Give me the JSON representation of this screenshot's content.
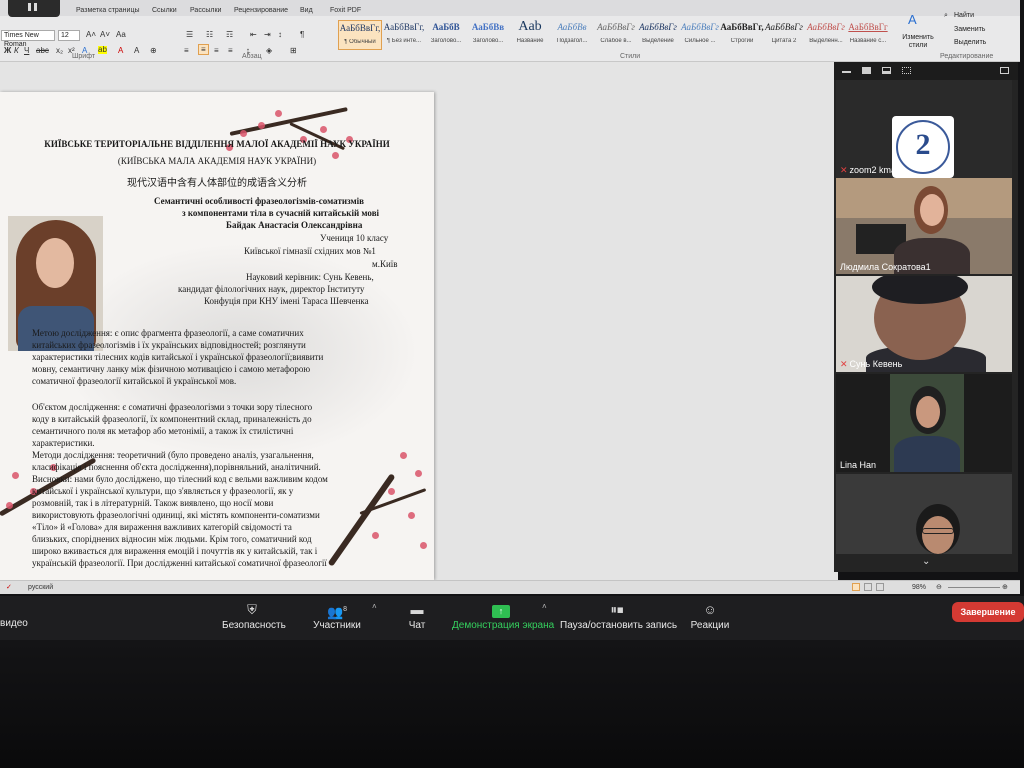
{
  "word": {
    "tabs": [
      "Разметка страницы",
      "Ссылки",
      "Рассылки",
      "Рецензирование",
      "Вид",
      "Foxit PDF"
    ],
    "font_name": "Times New Roman",
    "font_size": "12",
    "groups": {
      "font": "Шрифт",
      "paragraph": "Абзац",
      "styles": "Стили",
      "editing": "Редактирование"
    },
    "styles": [
      {
        "sample": "АаБбВвГг,",
        "name": "¶ Обычный"
      },
      {
        "sample": "АаБбВвГг,",
        "name": "¶ Без инте..."
      },
      {
        "sample": "АаБбВ",
        "name": "Заголово..."
      },
      {
        "sample": "АаБбВв",
        "name": "Заголово..."
      },
      {
        "sample": "Aab",
        "name": "Название"
      },
      {
        "sample": "АаБбВв",
        "name": "Подзагол..."
      },
      {
        "sample": "АаБбВвГг",
        "name": "Слабое в..."
      },
      {
        "sample": "АаБбВвГг",
        "name": "Выделение"
      },
      {
        "sample": "АаБбВвГг",
        "name": "Сильное ..."
      },
      {
        "sample": "АаБбВвГг,",
        "name": "Строгий"
      },
      {
        "sample": "АаБбВвГг",
        "name": "Цитата 2"
      },
      {
        "sample": "АаБбВвГг",
        "name": "Выделенн..."
      },
      {
        "sample": "АаБбВвГг",
        "name": "Название с..."
      }
    ],
    "change_styles": "Изменить стили",
    "find": "Найти",
    "replace": "Заменить",
    "select": "Выделить",
    "status_language": "русский",
    "zoom_level": "98%"
  },
  "document": {
    "title_line1": "КИЇВСЬКЕ ТЕРИТОРІАЛЬНЕ ВІДДІЛЕННЯ МАЛОЇ АКАДЕМІЇ НАУК УКРАЇНИ",
    "title_line2": "(КИЇВСЬКА МАЛА АКАДЕМІЯ НАУК УКРАЇНИ)",
    "chinese_title": "现代汉语中含有人体部位的成语含义分析",
    "topic1": "Семантичні особливості фразеологізмів-соматизмів",
    "topic2": "з компонентами тіла в сучасній китайській мові",
    "author": "Байдак Анастасія Олександрівна",
    "grade": "Учениця 10 класу",
    "school": "Київської гімназії східних мов №1",
    "city": "м.Київ",
    "supervisor": "Науковий керівник: Сунь Кевень,",
    "supervisor_title": "кандидат філологічних наук, директор Інституту",
    "supervisor_org": "Конфуція при КНУ імені Тараса Шевченка",
    "body": [
      "Метою дослідження: є опис фрагмента фразеології, а саме соматичних",
      "китайських фразеологізмів  і їх українських відповідностей; розглянути",
      "характеристики тілесних кодів китайської і української фразеології;виявити",
      "мовну, семантичну ланку між фізичною мотивацією і самою метафорою",
      "соматичної фразеології китайської й української мов.",
      "",
      "Об'єктом дослідження: є соматичні фразеологізми з точки зору тілесного",
      "коду в китайській фразеології, їх компонентний склад, приналежність до",
      "семантичного поля як метафор або метонімії, а також їх стилістичні",
      "характеристики.",
      "Методи дослідження: теоретичний (було проведено аналіз, узагальнення,",
      "класифікація і пояснення об'єкта дослідження),порівняльний, аналітичний.",
      "Висновки: нами було досліджено, що тілесний код є вельми важливим кодом",
      "китайської і української культури, що з'являється у фразеології, як у",
      "розмовній, так і в літературній. Також виявлено, що носії мови",
      "використовують фразеологічні одиниці, які містять компоненти-соматизми",
      "«Тіло» й «Голова» для вираження важливих категорій свідомості та",
      "близьких, споріднених відносин між людьми. Крім того, соматичний код",
      "широко вживається для вираження емоцій і почуттів як у китайській, так і",
      "українській фразеології. При дослідженні китайської соматичної фразеології"
    ]
  },
  "zoom": {
    "participants": [
      {
        "name": "zoom2 kman",
        "muted": true
      },
      {
        "name": "Людмила Сократова1",
        "muted": false
      },
      {
        "name": "Сунь Кевень",
        "muted": true
      },
      {
        "name": "Lina Han",
        "muted": false
      },
      {
        "name": "",
        "muted": false
      }
    ],
    "logo_number": "2",
    "controls": {
      "video": "видео",
      "security": "Безопасность",
      "participants": "Участники",
      "participants_count": "8",
      "chat": "Чат",
      "share": "Демонстрация экрана",
      "record": "Пауза/остановить запись",
      "reactions": "Реакции",
      "end": "Завершение"
    }
  },
  "colors": {
    "share_green": "#35d05e",
    "end_red": "#d43a33",
    "blossom": "#d9536a",
    "muted_red": "#e04040"
  }
}
